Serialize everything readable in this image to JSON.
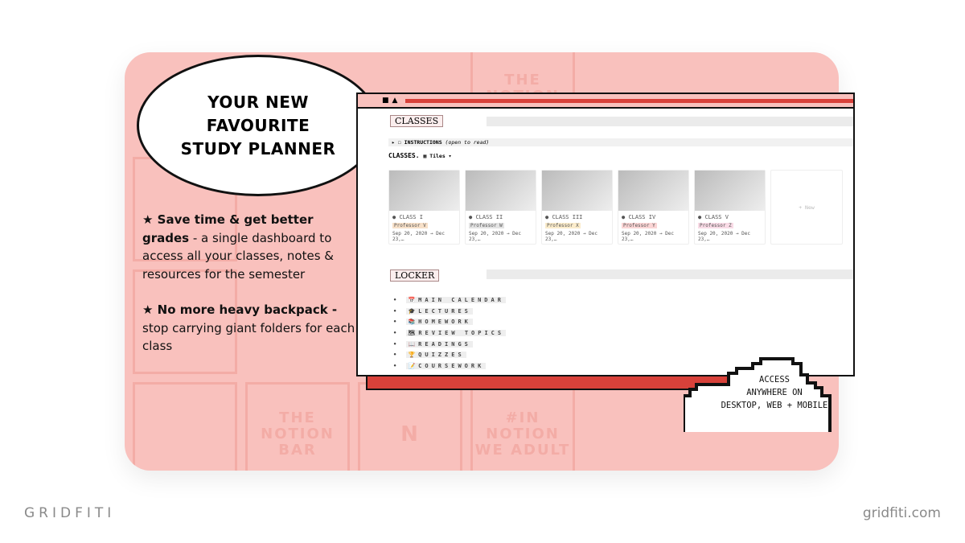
{
  "bubble": {
    "line1": "YOUR NEW",
    "line2": "FAVOURITE",
    "line3": "STUDY PLANNER"
  },
  "bullets": [
    {
      "bold": "★ Save time & get better grades",
      "text": " - a single dashboard to access all your classes, notes & resources for the semester"
    },
    {
      "bold": "★ No more heavy backpack -",
      "text": " stop carrying giant folders for each class"
    }
  ],
  "background_tiles": [
    "THE NOTION BAR",
    "#IN NOTION WE ADULT",
    "N",
    "THE NOTION BAR",
    "#IN NOTION WE ADULT",
    "BAR"
  ],
  "window": {
    "classes_header": "CLASSES",
    "instructions": "INSTRUCTIONS",
    "instructions_note": "(open to read)",
    "db_title": "CLASSES.",
    "view": "Tiles",
    "classes": [
      {
        "name": "CLASS I",
        "prof": "Professor V",
        "dates": "Sep 20, 2020 → Dec 23,…",
        "tag": "#f7e0c8"
      },
      {
        "name": "CLASS II",
        "prof": "Professor W",
        "dates": "Sep 20, 2020 → Dec 23,…",
        "tag": "#e3e3e3"
      },
      {
        "name": "CLASS III",
        "prof": "Professor X",
        "dates": "Sep 20, 2020 → Dec 23,…",
        "tag": "#fbeccb"
      },
      {
        "name": "CLASS IV",
        "prof": "Professor Y",
        "dates": "Sep 20, 2020 → Dec 23,…",
        "tag": "#fbd5d5"
      },
      {
        "name": "CLASS V",
        "prof": "Professor Z",
        "dates": "Sep 20, 2020 → Dec 23,…",
        "tag": "#f9dbe6"
      }
    ],
    "new_label": "+ New",
    "locker_header": "LOCKER",
    "locker": [
      "📅MAIN CALENDAR",
      "🎓LECTURES",
      "📚HOMEWORK",
      "🗺REVIEW TOPICS",
      "📖READINGS",
      "🏆QUIZZES",
      "📝COURSEWORK"
    ]
  },
  "cloud": {
    "line1": "ACCESS",
    "line2": "ANYWHERE ON",
    "line3": "DESKTOP, WEB + MOBILE"
  },
  "footer": {
    "brand": "GRIDFITI",
    "url": "gridfiti.com"
  },
  "colors": {
    "background": "#f9c1bd",
    "accent": "#d8413a"
  }
}
